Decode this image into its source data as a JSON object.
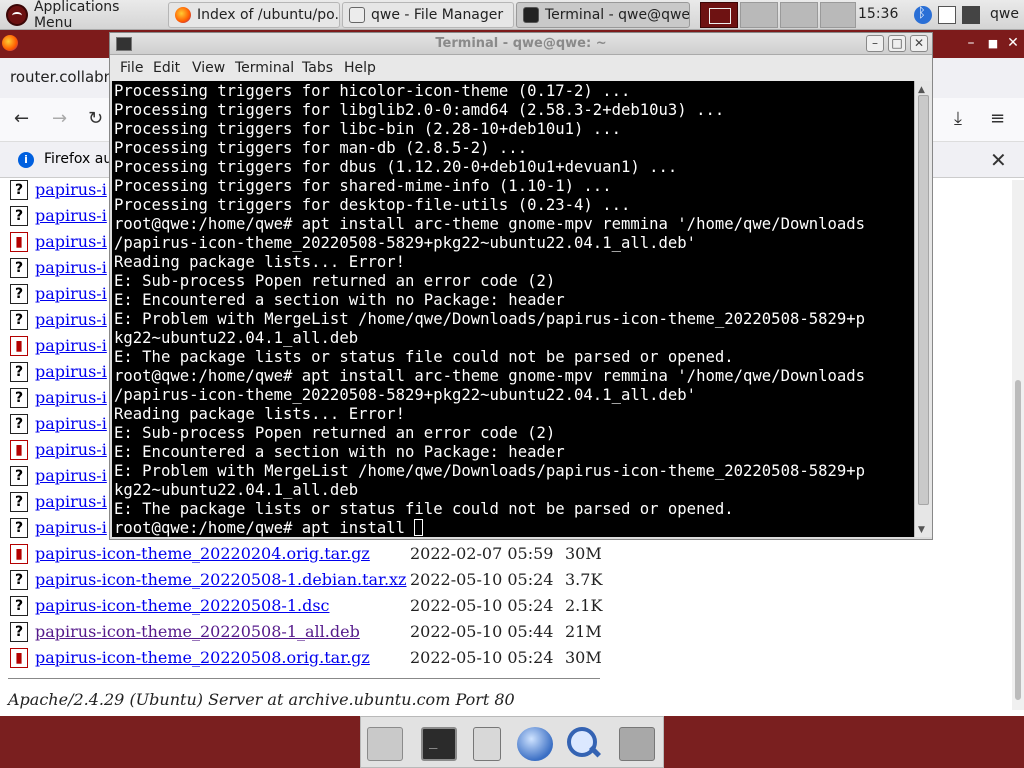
{
  "panel": {
    "app_menu": "Applications Menu",
    "tasks": [
      {
        "label": "Index of /ubuntu/po...",
        "icon": "firefox-icon"
      },
      {
        "label": "qwe - File Manager",
        "icon": "file-manager-icon"
      },
      {
        "label": "Terminal - qwe@qwe...",
        "icon": "terminal-icon"
      }
    ],
    "clock": "15:36",
    "user": "qwe"
  },
  "firefox": {
    "url_partial": "router.collabne",
    "notice_text": "Firefox au",
    "listing": [
      {
        "name": "papirus-i",
        "icon": "?",
        "type": "unknown"
      },
      {
        "name": "papirus-i",
        "icon": "?",
        "type": "unknown"
      },
      {
        "name": "papirus-i",
        "icon": "▮",
        "type": "archive"
      },
      {
        "name": "papirus-i",
        "icon": "?",
        "type": "unknown"
      },
      {
        "name": "papirus-i",
        "icon": "?",
        "type": "unknown"
      },
      {
        "name": "papirus-i",
        "icon": "?",
        "type": "unknown"
      },
      {
        "name": "papirus-i",
        "icon": "▮",
        "type": "archive"
      },
      {
        "name": "papirus-i",
        "icon": "?",
        "type": "unknown"
      },
      {
        "name": "papirus-i",
        "icon": "?",
        "type": "unknown"
      },
      {
        "name": "papirus-i",
        "icon": "?",
        "type": "unknown"
      },
      {
        "name": "papirus-i",
        "icon": "▮",
        "type": "archive"
      },
      {
        "name": "papirus-i",
        "icon": "?",
        "type": "unknown"
      },
      {
        "name": "papirus-i",
        "icon": "?",
        "type": "unknown"
      },
      {
        "name": "papirus-i",
        "icon": "?",
        "type": "unknown"
      },
      {
        "name": "papirus-icon-theme_20220204.orig.tar.gz",
        "icon": "▮",
        "type": "archive",
        "date": "2022-02-07 05:59",
        "size": "30M"
      },
      {
        "name": "papirus-icon-theme_20220508-1.debian.tar.xz",
        "icon": "?",
        "type": "unknown",
        "date": "2022-05-10 05:24",
        "size": "3.7K"
      },
      {
        "name": "papirus-icon-theme_20220508-1.dsc",
        "icon": "?",
        "type": "unknown",
        "date": "2022-05-10 05:24",
        "size": "2.1K"
      },
      {
        "name": "papirus-icon-theme_20220508-1_all.deb",
        "icon": "?",
        "type": "unknown",
        "date": "2022-05-10 05:44",
        "size": "21M",
        "visited": true
      },
      {
        "name": "papirus-icon-theme_20220508.orig.tar.gz",
        "icon": "▮",
        "type": "archive",
        "date": "2022-05-10 05:24",
        "size": "30M"
      }
    ],
    "address": "Apache/2.4.29 (Ubuntu) Server at archive.ubuntu.com Port 80"
  },
  "terminal": {
    "title": "Terminal - qwe@qwe: ~",
    "menu": [
      "File",
      "Edit",
      "View",
      "Terminal",
      "Tabs",
      "Help"
    ],
    "lines": [
      "Processing triggers for hicolor-icon-theme (0.17-2) ...",
      "Processing triggers for libglib2.0-0:amd64 (2.58.3-2+deb10u3) ...",
      "Processing triggers for libc-bin (2.28-10+deb10u1) ...",
      "Processing triggers for man-db (2.8.5-2) ...",
      "Processing triggers for dbus (1.12.20-0+deb10u1+devuan1) ...",
      "Processing triggers for shared-mime-info (1.10-1) ...",
      "Processing triggers for desktop-file-utils (0.23-4) ...",
      "root@qwe:/home/qwe# apt install arc-theme gnome-mpv remmina '/home/qwe/Downloads",
      "/papirus-icon-theme_20220508-5829+pkg22~ubuntu22.04.1_all.deb'",
      "Reading package lists... Error!",
      "E: Sub-process Popen returned an error code (2)",
      "E: Encountered a section with no Package: header",
      "E: Problem with MergeList /home/qwe/Downloads/papirus-icon-theme_20220508-5829+p",
      "kg22~ubuntu22.04.1_all.deb",
      "E: The package lists or status file could not be parsed or opened.",
      "root@qwe:/home/qwe# apt install arc-theme gnome-mpv remmina '/home/qwe/Downloads",
      "/papirus-icon-theme_20220508-5829+pkg22~ubuntu22.04.1_all.deb'",
      "Reading package lists... Error!",
      "E: Sub-process Popen returned an error code (2)",
      "E: Encountered a section with no Package: header",
      "E: Problem with MergeList /home/qwe/Downloads/papirus-icon-theme_20220508-5829+p",
      "kg22~ubuntu22.04.1_all.deb",
      "E: The package lists or status file could not be parsed or opened."
    ],
    "prompt": "root@qwe:/home/qwe# apt install "
  },
  "dock": {
    "items": [
      "home-folder-icon",
      "terminal-icon",
      "file-cabinet-icon",
      "web-browser-icon",
      "search-icon",
      "folder-icon"
    ]
  },
  "colors": {
    "desktop": "#7a1f1f",
    "link": "#0000ee",
    "visited": "#551a8b",
    "terminal_bg": "#000000"
  }
}
